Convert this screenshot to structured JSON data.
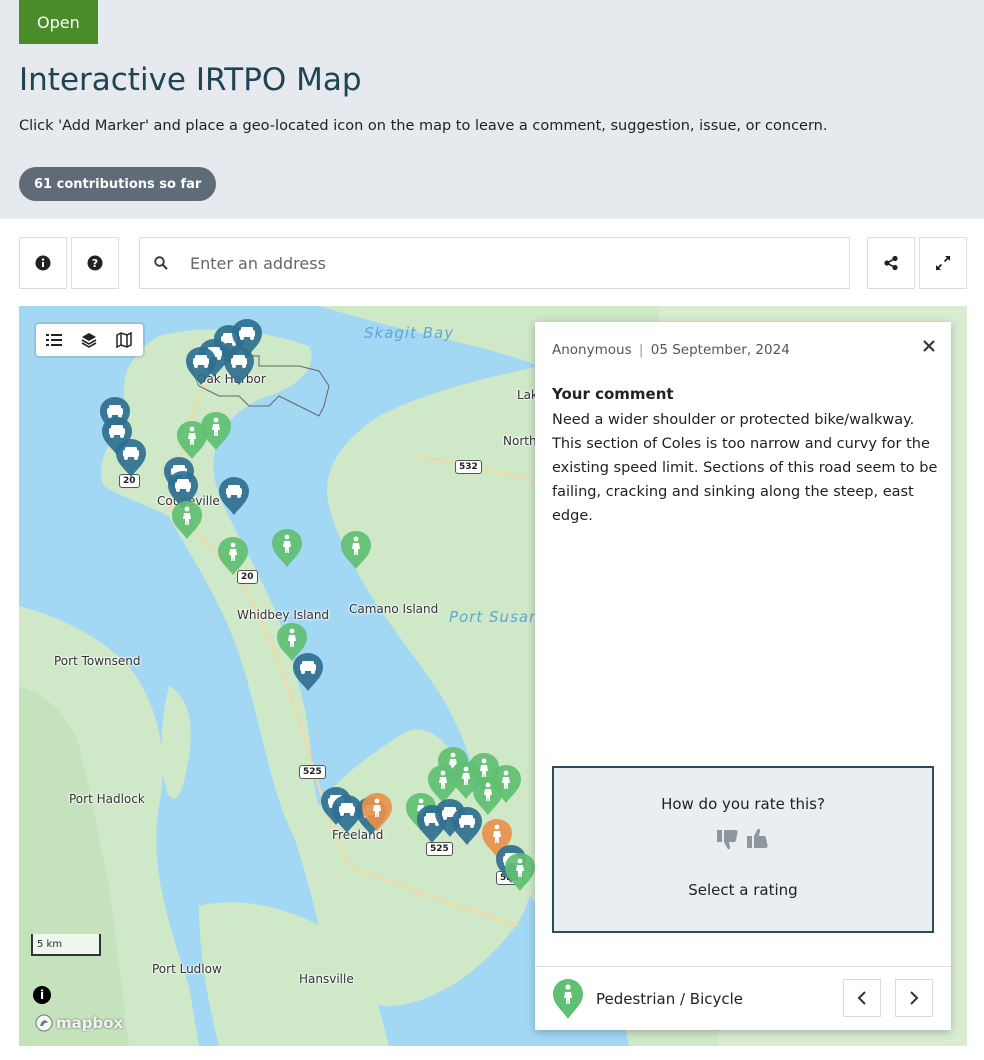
{
  "header": {
    "status": "Open",
    "title": "Interactive IRTPO Map",
    "subtitle": "Click 'Add Marker' and place a geo-located icon on the map to leave a comment, suggestion, issue, or concern.",
    "contributions": "61 contributions so far"
  },
  "toolbar": {
    "info_icon": "info-icon",
    "help_icon": "question-icon",
    "search_placeholder": "Enter an address",
    "share_icon": "share-icon",
    "fullscreen_icon": "expand-icon"
  },
  "map": {
    "labels": {
      "skagit_bay": "Skagit Bay",
      "oak_harbor": "Oak Harbor",
      "coupeville": "Coupeville",
      "whidbey": "Whidbey Island",
      "camano": "Camano Island",
      "port_susan": "Port Susan",
      "port_townsend": "Port Townsend",
      "port_hadlock": "Port Hadlock",
      "freeland": "Freeland",
      "port_ludlow": "Port Ludlow",
      "hansville": "Hansville",
      "lake": "Lak",
      "north": "North"
    },
    "shields": [
      "20",
      "20",
      "532",
      "525",
      "525",
      "525"
    ],
    "scale": "5 km",
    "attribution": "mapbox"
  },
  "panel": {
    "author": "Anonymous",
    "date": "05 September, 2024",
    "heading": "Your comment",
    "comment": "Need a wider shoulder or protected bike/walkway. This section of Coles is too narrow and curvy for the existing speed limit. Sections of this road seem to be failing, cracking and sinking along the steep, east edge.",
    "rating_question": "How do you rate this?",
    "rating_prompt": "Select a rating",
    "category": "Pedestrian / Bicycle"
  },
  "colors": {
    "status_green": "#4a8c2a",
    "title_blue": "#1e4455",
    "pin_pedestrian": "#5fbf72",
    "pin_vehicle": "#2f6f8f",
    "pin_orange": "#e8914a",
    "water": "#a3d8f5"
  }
}
